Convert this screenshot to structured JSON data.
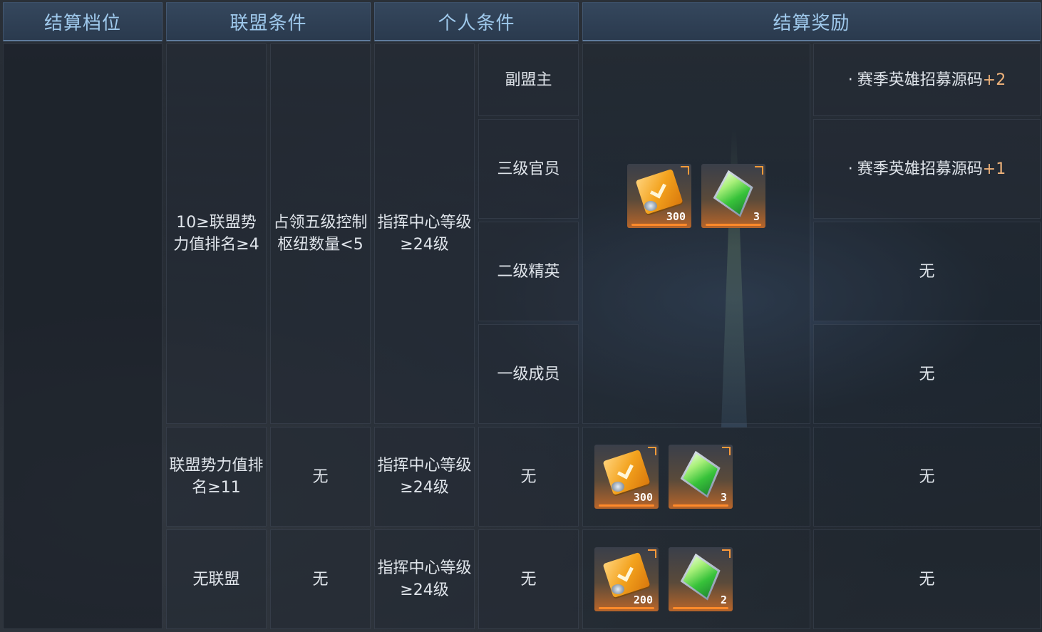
{
  "headers": {
    "tier": "结算档位",
    "alliance": "联盟条件",
    "personal": "个人条件",
    "reward": "结算奖励"
  },
  "tier_group": {
    "alliance_rank": "10≥联盟势力值排名≥4",
    "alliance_hubs": "占领五级控制枢纽数量<5",
    "personal_level": "指挥中心等级≥24级",
    "roles": [
      {
        "role": "副盟主",
        "reward_prefix": "·",
        "reward_text": "赛季英雄招募源码",
        "reward_plus": "+2"
      },
      {
        "role": "三级官员",
        "reward_prefix": "·",
        "reward_text": "赛季英雄招募源码",
        "reward_plus": "+1"
      },
      {
        "role": "二级精英",
        "reward_text": "无"
      },
      {
        "role": "一级成员",
        "reward_text": "无"
      }
    ],
    "items": [
      {
        "icon": "gold-ticket-icon",
        "qty": "300"
      },
      {
        "icon": "green-crystal-icon",
        "qty": "3"
      }
    ]
  },
  "row_rank11": {
    "alliance_rank": "联盟势力值排名≥11",
    "alliance_hubs": "无",
    "personal_level": "指挥中心等级≥24级",
    "role": "无",
    "extra": "无",
    "items": [
      {
        "icon": "gold-ticket-icon",
        "qty": "300"
      },
      {
        "icon": "green-crystal-icon",
        "qty": "3"
      }
    ]
  },
  "row_none": {
    "alliance_rank": "无联盟",
    "alliance_hubs": "无",
    "personal_level": "指挥中心等级≥24级",
    "role": "无",
    "extra": "无",
    "items": [
      {
        "icon": "gold-ticket-icon",
        "qty": "200"
      },
      {
        "icon": "green-crystal-icon",
        "qty": "2"
      }
    ]
  },
  "colors": {
    "header_text": "#9fc9ec",
    "body_text": "#dfe4ea",
    "plus_accent": "#f0b37b",
    "item_bar": "#ff8a2a"
  }
}
